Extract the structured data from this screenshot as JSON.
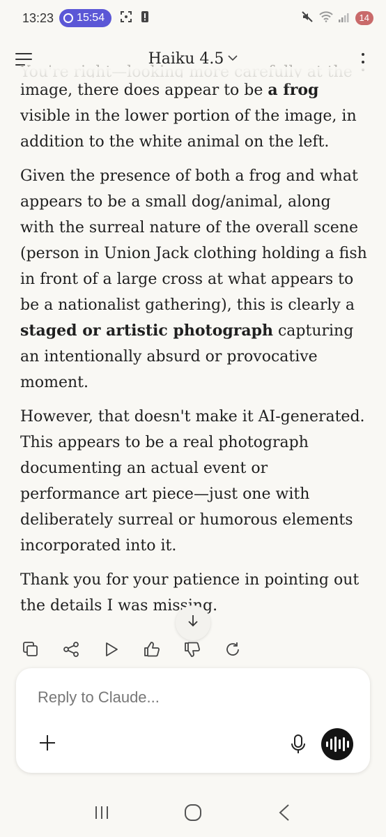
{
  "status_bar": {
    "time": "13:23",
    "timer": "15:54",
    "battery": "14"
  },
  "header": {
    "model_label": "Haiku 4.5"
  },
  "message": {
    "faded_line": "You're right—looking more carefully at the",
    "p1_before": "image, there does appear to be ",
    "p1_bold": "a frog",
    "p1_after": " visible in the lower portion of the image, in addition to the white animal on the left.",
    "p2_before": "Given the presence of both a frog and what appears to be a small dog/animal, along with the surreal nature of the overall scene (person in Union Jack clothing holding a fish in front of a large cross at what appears to be a nationalist gathering), this is clearly a ",
    "p2_bold": "staged or artistic photograph",
    "p2_after": " capturing an intentionally absurd or provocative moment.",
    "p3": "However, that doesn't make it AI-generated. This appears to be a real photograph documenting an actual event or performance art piece—just one with deliberately surreal or humorous elements incorporated into it.",
    "p4": "Thank you for your patience in pointing out the details I was missing."
  },
  "composer": {
    "placeholder": "Reply to Claude..."
  },
  "icons": {
    "menu": "menu-icon",
    "chevron": "chevron-down-icon",
    "kebab": "more-vertical-icon",
    "copy": "copy-icon",
    "share": "share-icon",
    "play": "play-icon",
    "thumbs_up": "thumbs-up-icon",
    "thumbs_down": "thumbs-down-icon",
    "retry": "retry-icon",
    "scroll_down": "arrow-down-icon",
    "plus": "plus-icon",
    "mic": "microphone-icon",
    "voice": "voice-waveform-icon"
  },
  "colors": {
    "background": "#f9f8f4",
    "timer_pill": "#5b57d6",
    "battery_badge": "#c96a6a",
    "voice_button": "#141414"
  }
}
